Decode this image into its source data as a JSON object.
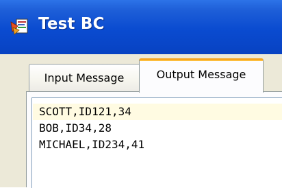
{
  "window": {
    "title": "Test BC",
    "icon": "java-app-icon"
  },
  "tabs": [
    {
      "label": "Input Message",
      "selected": false
    },
    {
      "label": "Output Message",
      "selected": true
    }
  ],
  "output": {
    "lines": [
      "SCOTT,ID121,34",
      "BOB,ID34,28",
      "MICHAEL,ID234,41"
    ]
  },
  "colors": {
    "titlebar": "#0a4bd0",
    "tab_highlight": "#f5a623",
    "current_line": "#fffbe2"
  }
}
